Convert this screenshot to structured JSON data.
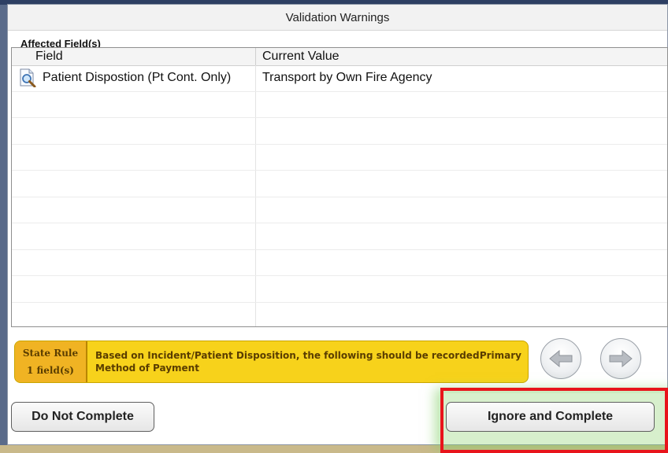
{
  "dialog": {
    "title": "Validation Warnings",
    "section_label": "Affected Field(s)"
  },
  "grid": {
    "columns": [
      "Field",
      "Current Value"
    ],
    "rows": [
      {
        "icon": "document-magnifier-icon",
        "field": "Patient Dispostion (Pt Cont. Only)",
        "value": "Transport by Own Fire Agency"
      },
      {
        "field": "",
        "value": ""
      },
      {
        "field": "",
        "value": ""
      },
      {
        "field": "",
        "value": ""
      },
      {
        "field": "",
        "value": ""
      },
      {
        "field": "",
        "value": ""
      },
      {
        "field": "",
        "value": ""
      },
      {
        "field": "",
        "value": ""
      },
      {
        "field": "",
        "value": ""
      },
      {
        "field": "",
        "value": ""
      }
    ]
  },
  "warning": {
    "rule_type": "State Rule",
    "field_count": "1 field(s)",
    "message_line1": "Based on Incident/Patient Disposition, the following should be recorded:",
    "message_right": "Primary",
    "message_line2": "Method of Payment"
  },
  "navigation": {
    "prev_icon": "arrow-left-icon",
    "next_icon": "arrow-right-icon"
  },
  "buttons": {
    "do_not_complete": "Do Not Complete",
    "ignore_and_complete": "Ignore and Complete"
  },
  "colors": {
    "warning_bg": "#f7d21b",
    "rule_bg": "#f0b323",
    "highlight_border": "#e8141b",
    "highlight_glow": "#8cd26e"
  }
}
